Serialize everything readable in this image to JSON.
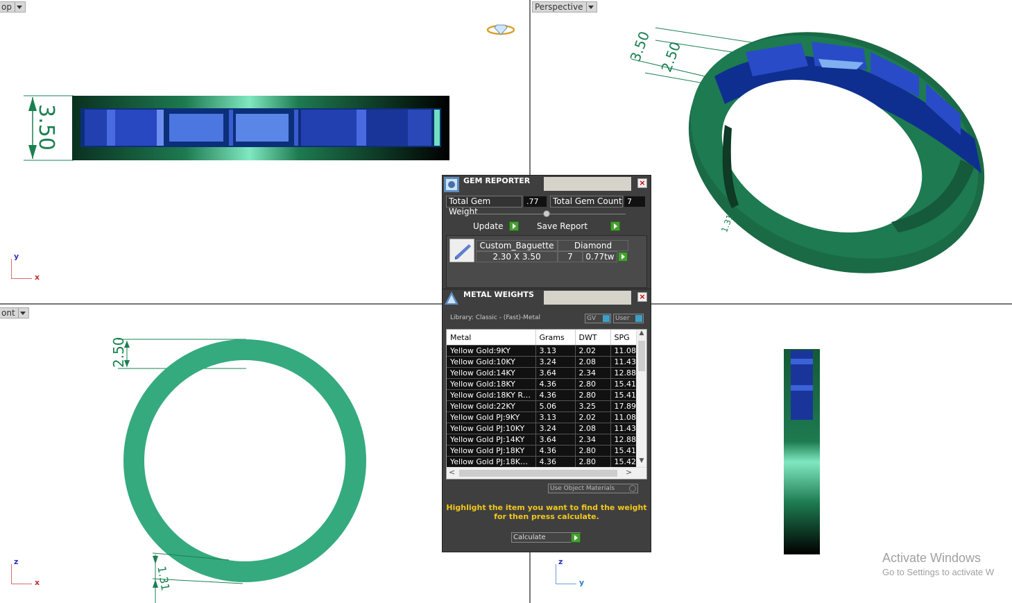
{
  "viewports": {
    "top": {
      "label": "op"
    },
    "perspective": {
      "label": "Perspective"
    },
    "front": {
      "label": "ont"
    }
  },
  "dimensions": {
    "top_height": "3.50",
    "persp_a": "3.50",
    "persp_b": "2.50",
    "persp_c": "1.31",
    "front_width": "2.50",
    "front_bottom": "1.31"
  },
  "axes": {
    "top": {
      "v": "y",
      "h": "x"
    },
    "front": {
      "v": "z",
      "h": "x"
    },
    "right": {
      "v": "z",
      "h": "y"
    }
  },
  "gem_reporter": {
    "title": "GEM REPORTER",
    "total_weight_label": "Total Gem Weight",
    "total_weight_value": ".77",
    "total_count_label": "Total Gem Count",
    "total_count_value": "7",
    "update_label": "Update",
    "save_report_label": "Save Report",
    "gem": {
      "shape": "Custom_Baguette",
      "material": "Diamond",
      "size": "2.30 X 3.50",
      "count": "7",
      "weight": "0.77tw"
    }
  },
  "metal_weights": {
    "title": "METAL WEIGHTS",
    "library": "Library: Classic - (Fast)-Metal",
    "gv_label": "GV",
    "user_label": "User",
    "columns": [
      "Metal",
      "Grams",
      "DWT",
      "SPG"
    ],
    "rows": [
      [
        "Yellow Gold:9KY",
        "3.13",
        "2.02",
        "11.08"
      ],
      [
        "Yellow Gold:10KY",
        "3.24",
        "2.08",
        "11.43"
      ],
      [
        "Yellow Gold:14KY",
        "3.64",
        "2.34",
        "12.88"
      ],
      [
        "Yellow Gold:18KY",
        "4.36",
        "2.80",
        "15.41"
      ],
      [
        "Yellow Gold:18KY R…",
        "4.36",
        "2.80",
        "15.41"
      ],
      [
        "Yellow Gold:22KY",
        "5.06",
        "3.25",
        "17.89"
      ],
      [
        "Yellow Gold PJ:9KY",
        "3.13",
        "2.02",
        "11.08"
      ],
      [
        "Yellow Gold PJ:10KY",
        "3.24",
        "2.08",
        "11.43"
      ],
      [
        "Yellow Gold PJ:14KY",
        "3.64",
        "2.34",
        "12.88"
      ],
      [
        "Yellow Gold PJ:18KY",
        "4.36",
        "2.80",
        "15.41"
      ],
      [
        "Yellow Gold PJ:18K…",
        "4.36",
        "2.80",
        "15.42"
      ]
    ],
    "use_object_materials": "Use Object Materials",
    "hint_line1": "Highlight the item you want to find the weight",
    "hint_line2": "for then press calculate.",
    "calculate_label": "Calculate"
  },
  "watermark": {
    "line1": "Activate Windows",
    "line2": "Go to Settings to activate W"
  },
  "colors": {
    "ring_green": "#1e7a50",
    "front_ring": "#35aa7f",
    "gem_blue": "#2a4bc8",
    "dim_green": "#1a8050",
    "panel_bg": "#3f3f3f",
    "hint_yellow": "#f2c81b"
  }
}
